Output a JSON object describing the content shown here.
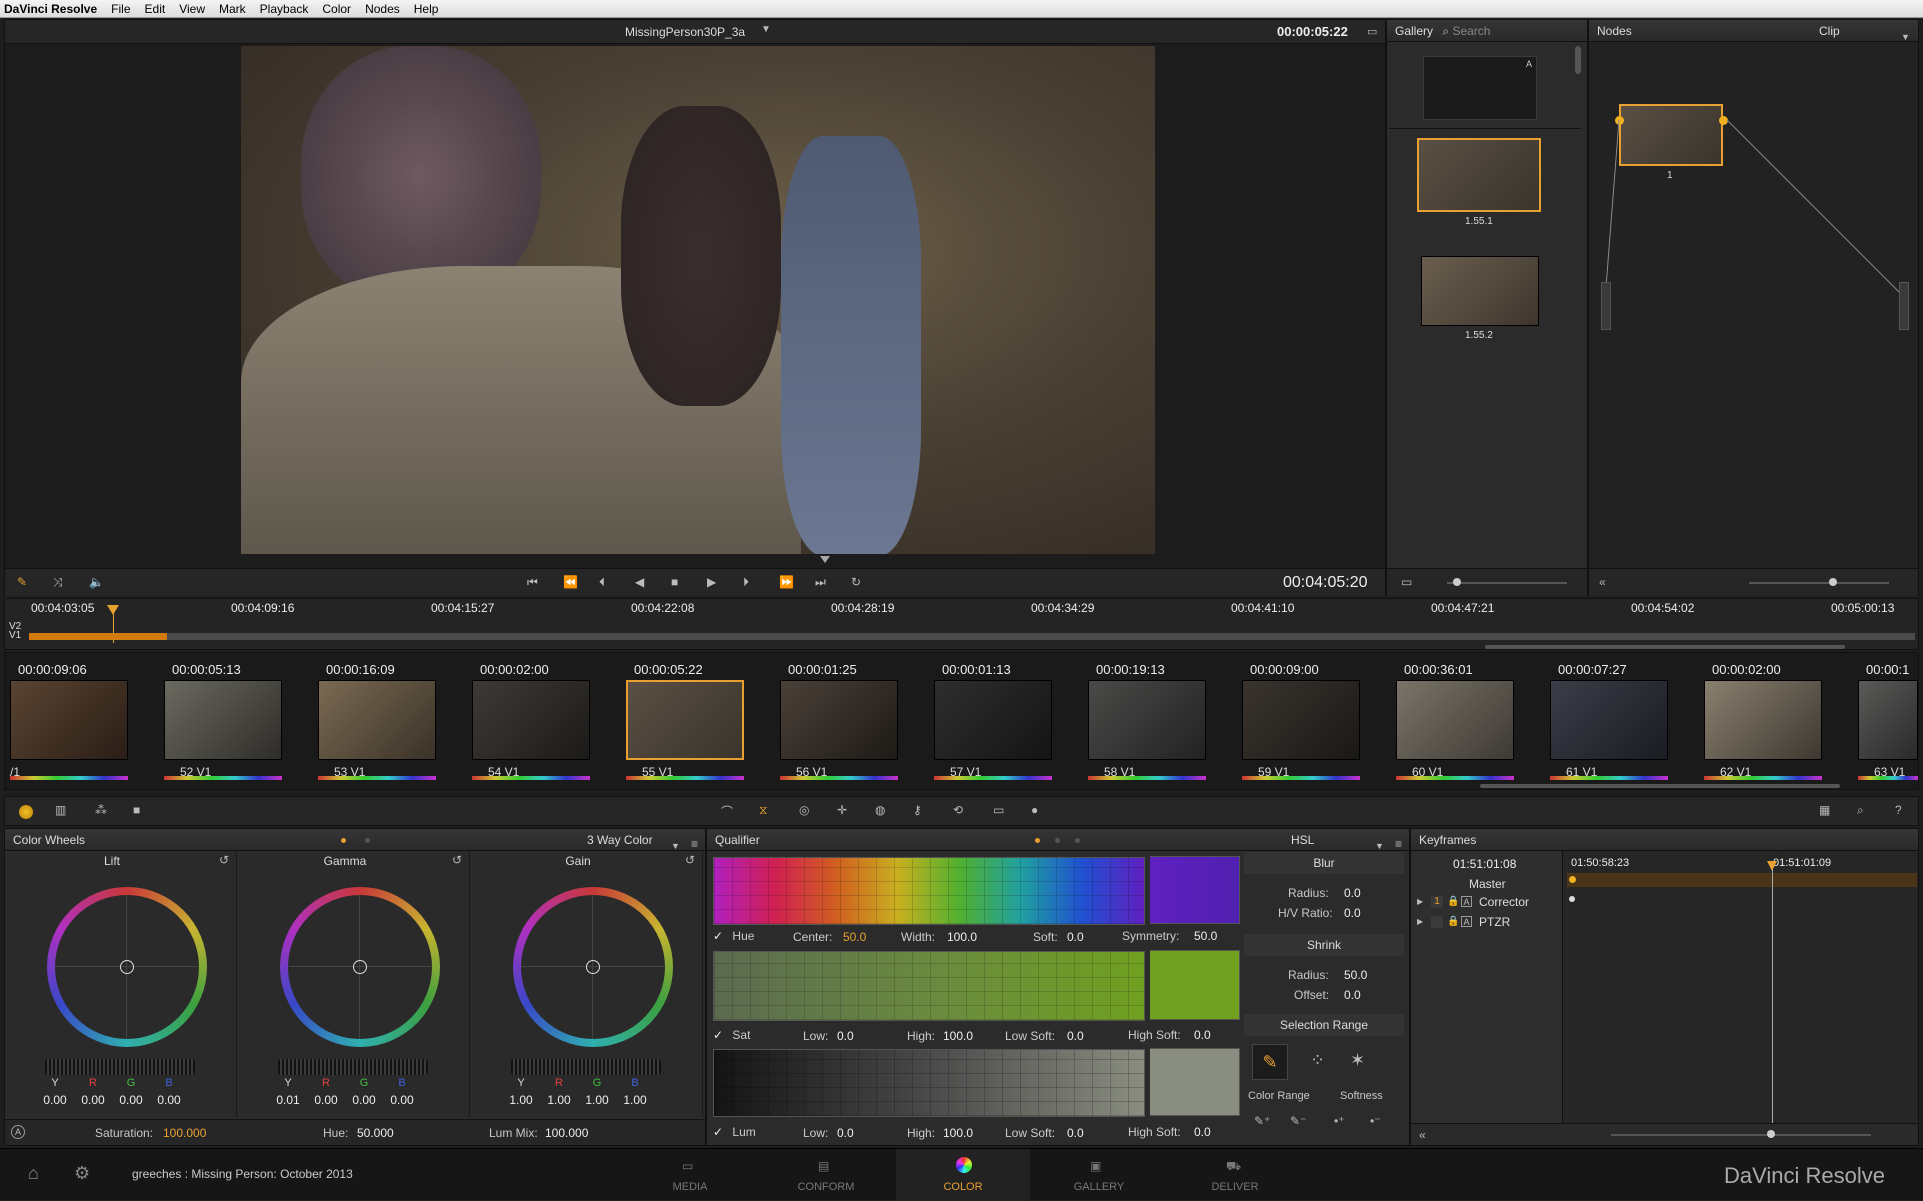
{
  "menubar": {
    "app": "DaVinci Resolve",
    "items": [
      "File",
      "Edit",
      "View",
      "Mark",
      "Playback",
      "Color",
      "Nodes",
      "Help"
    ]
  },
  "viewer": {
    "clip_name": "MissingPerson30P_3a",
    "timecode_top": "00:00:05:22",
    "timecode_bottom": "00:04:05:20"
  },
  "gallery": {
    "title": "Gallery",
    "search_placeholder": "Search",
    "stills": [
      "1.55.1",
      "1.55.2"
    ]
  },
  "nodes": {
    "title": "Nodes",
    "mode": "Clip",
    "node_label": "1"
  },
  "timeline": {
    "ruler": [
      "00:04:03:05",
      "00:04:09:16",
      "00:04:15:27",
      "00:04:22:08",
      "00:04:28:19",
      "00:04:34:29",
      "00:04:41:10",
      "00:04:47:21",
      "00:04:54:02",
      "00:05:00:13"
    ],
    "tracks": [
      "V2",
      "V1"
    ]
  },
  "clips": [
    {
      "tc": "00:00:09:06",
      "label": "/1"
    },
    {
      "tc": "00:00:05:13",
      "label": "52 V1"
    },
    {
      "tc": "00:00:16:09",
      "label": "53 V1"
    },
    {
      "tc": "00:00:02:00",
      "label": "54 V1"
    },
    {
      "tc": "00:00:05:22",
      "label": "55 V1"
    },
    {
      "tc": "00:00:01:25",
      "label": "56 V1"
    },
    {
      "tc": "00:00:01:13",
      "label": "57 V1"
    },
    {
      "tc": "00:00:19:13",
      "label": "58 V1"
    },
    {
      "tc": "00:00:09:00",
      "label": "59 V1"
    },
    {
      "tc": "00:00:36:01",
      "label": "60 V1"
    },
    {
      "tc": "00:00:07:27",
      "label": "61 V1"
    },
    {
      "tc": "00:00:02:00",
      "label": "62 V1"
    },
    {
      "tc": "00:00:1",
      "label": "63 V1"
    }
  ],
  "color_wheels": {
    "title": "Color Wheels",
    "mode": "3 Way Color",
    "wheels": [
      {
        "name": "Lift",
        "y": "0.00",
        "r": "0.00",
        "g": "0.00",
        "b": "0.00"
      },
      {
        "name": "Gamma",
        "y": "0.01",
        "r": "0.00",
        "g": "0.00",
        "b": "0.00"
      },
      {
        "name": "Gain",
        "y": "1.00",
        "r": "1.00",
        "g": "1.00",
        "b": "1.00"
      }
    ],
    "channel_labels": {
      "y": "Y",
      "r": "R",
      "g": "G",
      "b": "B"
    },
    "saturation_label": "Saturation:",
    "saturation": "100.000",
    "hue_label": "Hue:",
    "hue": "50.000",
    "lummix_label": "Lum Mix:",
    "lummix": "100.000"
  },
  "qualifier": {
    "title": "Qualifier",
    "mode": "HSL",
    "hue": {
      "label": "Hue",
      "center_label": "Center:",
      "center": "50.0",
      "width_label": "Width:",
      "width": "100.0",
      "soft_label": "Soft:",
      "soft": "0.0",
      "sym_label": "Symmetry:",
      "sym": "50.0"
    },
    "sat": {
      "label": "Sat",
      "low_label": "Low:",
      "low": "0.0",
      "high_label": "High:",
      "high": "100.0",
      "lowsoft_label": "Low Soft:",
      "lowsoft": "0.0",
      "highsoft_label": "High Soft:",
      "highsoft": "0.0"
    },
    "lum": {
      "label": "Lum",
      "low_label": "Low:",
      "low": "0.0",
      "high_label": "High:",
      "high": "100.0",
      "lowsoft_label": "Low Soft:",
      "lowsoft": "0.0",
      "highsoft_label": "High Soft:",
      "highsoft": "0.0"
    },
    "blur": {
      "title": "Blur",
      "radius_label": "Radius:",
      "radius": "0.0",
      "hv_label": "H/V Ratio:",
      "hv": "0.0"
    },
    "shrink": {
      "title": "Shrink",
      "radius_label": "Radius:",
      "radius": "50.0",
      "offset_label": "Offset:",
      "offset": "0.0"
    },
    "selection": {
      "title": "Selection Range",
      "color_range": "Color Range",
      "softness": "Softness"
    }
  },
  "keyframes": {
    "title": "Keyframes",
    "tc_current": "01:51:01:08",
    "tc_start": "01:50:58:23",
    "tc_playhead": "01:51:01:09",
    "rows": [
      {
        "label": "Master"
      },
      {
        "num": "1",
        "label": "Corrector"
      },
      {
        "label": "PTZR"
      }
    ]
  },
  "footer": {
    "project": "greeches : Missing Person: October 2013",
    "tabs": [
      "MEDIA",
      "CONFORM",
      "COLOR",
      "GALLERY",
      "DELIVER"
    ],
    "brand": "DaVinci Resolve"
  }
}
